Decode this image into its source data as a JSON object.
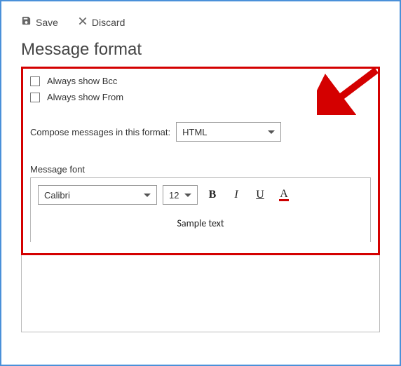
{
  "toolbar": {
    "save_label": "Save",
    "discard_label": "Discard"
  },
  "title": "Message format",
  "checkboxes": {
    "bcc_label": "Always show Bcc",
    "from_label": "Always show From"
  },
  "compose": {
    "label": "Compose messages in this format:",
    "value": "HTML"
  },
  "font_section": {
    "label": "Message font",
    "font_value": "Calibri",
    "size_value": "12",
    "sample": "Sample text"
  }
}
